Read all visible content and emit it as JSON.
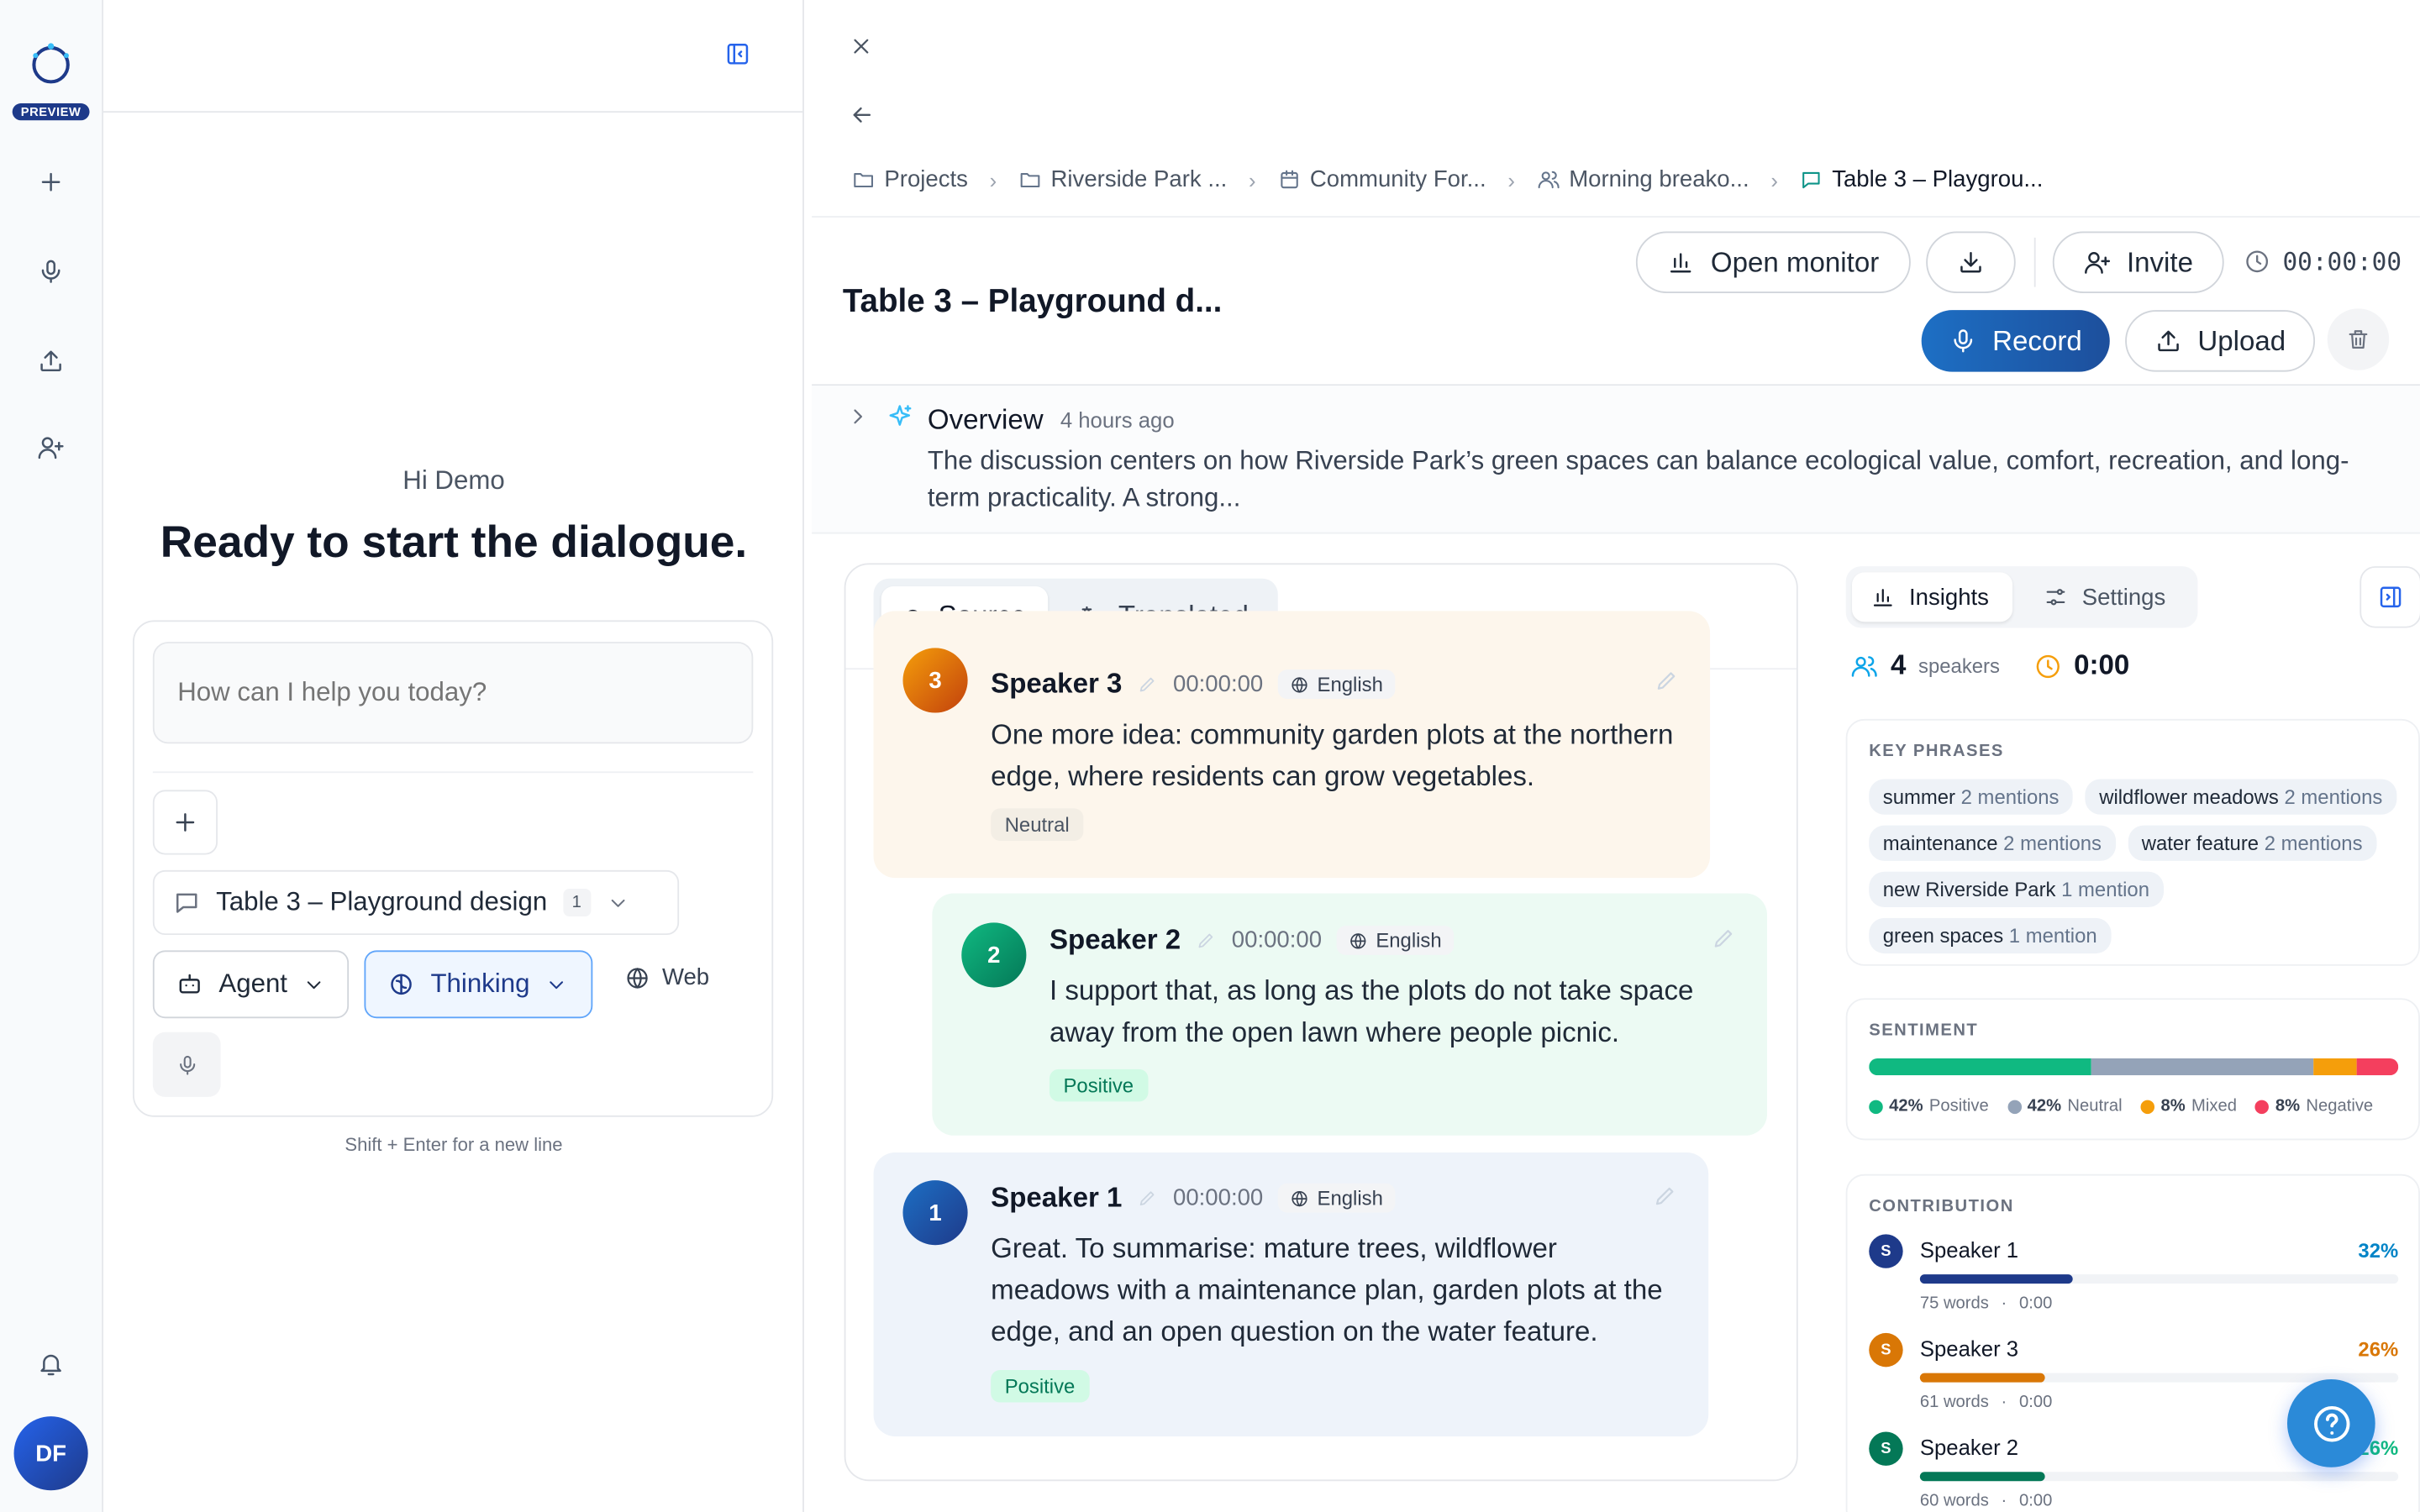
{
  "rail": {
    "badge": "PREVIEW",
    "avatar_initials": "DF"
  },
  "chat": {
    "greeting": "Hi Demo",
    "headline": "Ready to start the dialogue.",
    "input_placeholder": "How can I help you today?",
    "context_label": "Table 3 – Playground design",
    "context_count": "1",
    "mode_agent": "Agent",
    "mode_thinking": "Thinking",
    "web_label": "Web",
    "hint": "Shift + Enter for a new line"
  },
  "breadcrumbs": [
    "Projects",
    "Riverside Park ...",
    "Community For...",
    "Morning breako...",
    "Table 3 – Playgrou..."
  ],
  "header": {
    "title": "Table 3 – Playground d...",
    "open_monitor": "Open monitor",
    "invite": "Invite",
    "timer": "00:00:00",
    "record": "Record",
    "upload": "Upload"
  },
  "overview": {
    "title": "Overview",
    "time": "4 hours ago",
    "text": "The discussion centers on how Riverside Park’s green spaces can balance ecological value, comfort, recreation, and long-term practicality. A strong..."
  },
  "transcript": {
    "tab_source": "Source",
    "tab_translated": "Translated",
    "messages": [
      {
        "num": "3",
        "speaker": "Speaker 3",
        "time": "00:00:00",
        "lang": "English",
        "text": "One more idea: community garden plots at the northern edge, where residents can grow vegetables.",
        "sentiment": "Neutral"
      },
      {
        "num": "2",
        "speaker": "Speaker 2",
        "time": "00:00:00",
        "lang": "English",
        "text": "I support that, as long as the plots do not take space away from the open lawn where people picnic.",
        "sentiment": "Positive"
      },
      {
        "num": "1",
        "speaker": "Speaker 1",
        "time": "00:00:00",
        "lang": "English",
        "text": "Great. To summarise: mature trees, wildflower meadows with a maintenance plan, garden plots at the edge, and an open question on the water feature.",
        "sentiment": "Positive"
      }
    ]
  },
  "insights": {
    "tab_insights": "Insights",
    "tab_settings": "Settings",
    "speakers_count": "4",
    "speakers_label": "speakers",
    "duration": "0:00",
    "key_phrases_title": "KEY PHRASES",
    "key_phrases": [
      {
        "phrase": "summer",
        "count": "2 mentions"
      },
      {
        "phrase": "wildflower meadows",
        "count": "2 mentions"
      },
      {
        "phrase": "maintenance",
        "count": "2 mentions"
      },
      {
        "phrase": "water feature",
        "count": "2 mentions"
      },
      {
        "phrase": "new Riverside Park",
        "count": "1 mention"
      },
      {
        "phrase": "green spaces",
        "count": "1 mention"
      }
    ],
    "sentiment_title": "SENTIMENT",
    "sentiment": [
      {
        "label": "Positive",
        "pct": "42%",
        "value": 42,
        "color": "#10b981"
      },
      {
        "label": "Neutral",
        "pct": "42%",
        "value": 42,
        "color": "#94a3b8"
      },
      {
        "label": "Mixed",
        "pct": "8%",
        "value": 8,
        "color": "#f59e0b"
      },
      {
        "label": "Negative",
        "pct": "8%",
        "value": 8,
        "color": "#f43f5e"
      }
    ],
    "contribution_title": "CONTRIBUTION",
    "contribution": [
      {
        "initial": "S",
        "name": "Speaker 1",
        "pct": "32%",
        "value": 32,
        "words": "75 words",
        "time": "0:00",
        "color": "#1e3a8a",
        "pct_color": "#0284c7"
      },
      {
        "initial": "S",
        "name": "Speaker 3",
        "pct": "26%",
        "value": 26,
        "words": "61 words",
        "time": "0:00",
        "color": "#d97706",
        "pct_color": "#d97706"
      },
      {
        "initial": "S",
        "name": "Speaker 2",
        "pct": "26%",
        "value": 26,
        "words": "60 words",
        "time": "0:00",
        "color": "#047857",
        "pct_color": "#10b981"
      }
    ]
  }
}
